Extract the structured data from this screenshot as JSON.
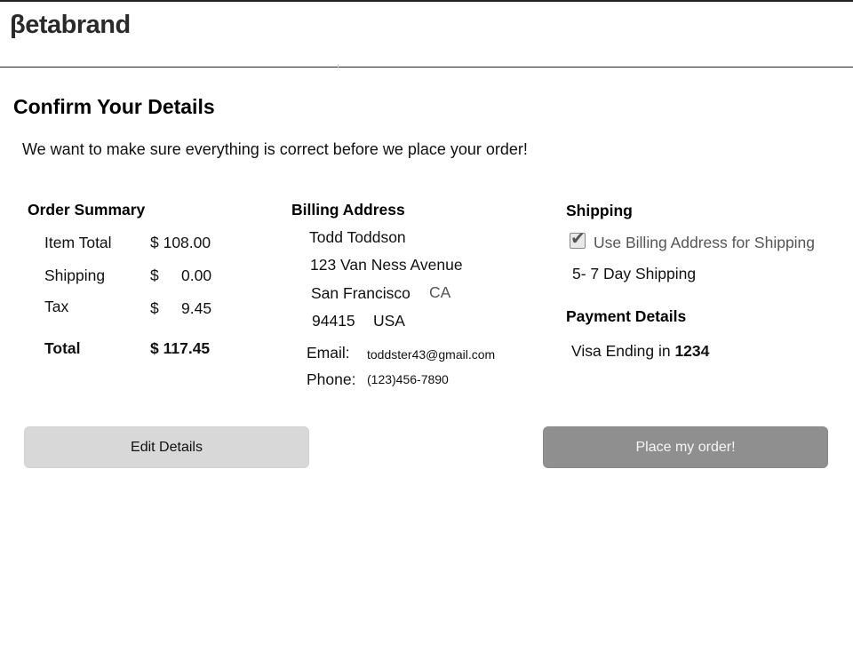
{
  "brand": {
    "logo_text": "βetabrand"
  },
  "page": {
    "title": "Confirm Your Details",
    "intro": "We want to make sure everything is correct before we place your order!"
  },
  "order_summary": {
    "title": "Order Summary",
    "item_total_label": "Item Total",
    "item_total_value": "$ 108.00",
    "shipping_label": "Shipping",
    "shipping_currency": "$",
    "shipping_value": "0.00",
    "tax_label": "Tax",
    "tax_currency": "$",
    "tax_value": "9.45",
    "total_label": "Total",
    "total_value": "$ 117.45"
  },
  "billing": {
    "title": "Billing Address",
    "name": "Todd Toddson",
    "street": "123 Van Ness Avenue",
    "city": "San Francisco",
    "state": "CA",
    "zip": "94415",
    "country": "USA",
    "email_label": "Email:",
    "email_value": "toddster43@gmail.com",
    "phone_label": "Phone:",
    "phone_value": "(123)456-7890"
  },
  "shipping": {
    "title": "Shipping",
    "use_billing_label": "Use Billing Address for Shipping",
    "use_billing_checked": true,
    "method": "5- 7 Day Shipping"
  },
  "payment": {
    "title": "Payment Details",
    "card_prefix": "Visa Ending in",
    "card_last4": "1234"
  },
  "actions": {
    "edit_label": "Edit Details",
    "place_label": "Place my order!"
  }
}
